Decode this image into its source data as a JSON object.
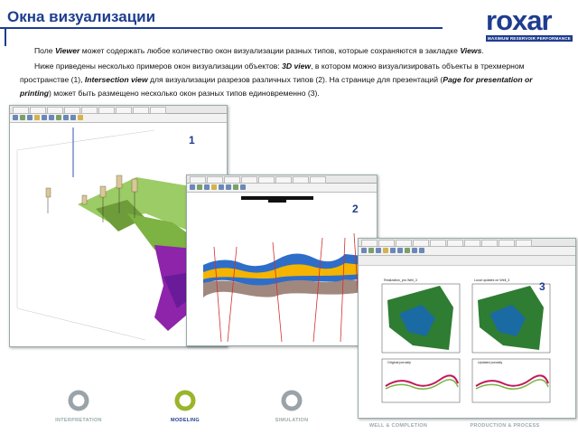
{
  "header": {
    "title": "Окна визуализации",
    "logo_text": "roxar",
    "logo_tagline": "MAXIMUM RESERVOIR PERFORMANCE"
  },
  "body_text": {
    "p1_a": "Поле ",
    "p1_b": "Viewer",
    "p1_c": " может содержать любое количество окон визуализации разных типов, которые сохраняются в закладке ",
    "p1_d": "Views",
    "p1_e": ".",
    "p2_a": "Ниже приведены несколько примеров окон визуализации объектов: ",
    "p2_b": "3D view",
    "p2_c": ", в котором можно визуализировать объекты в трехмерном пространстве (1), ",
    "p2_d": "Intersection view",
    "p2_e": " для визуализации разрезов различных типов (2). На странице для презентаций (",
    "p2_f": "Page for presentation or printing",
    "p2_g": ") может быть размещено несколько окон разных типов единовременно (3)."
  },
  "figures": {
    "label_1": "1",
    "label_2": "2",
    "label_3": "3",
    "w3_map1_title": "Realization_pro Well_3",
    "w3_map2_title": "Local updates on Well_3",
    "w3_log1_title": "Original porosity",
    "w3_log2_title": "Updated porosity"
  },
  "workflow": {
    "items": [
      {
        "label": "INTERPRETATION",
        "active": false
      },
      {
        "label": "MODELING",
        "active": true
      },
      {
        "label": "SIMULATION",
        "active": false
      },
      {
        "label": "WELL & COMPLETION",
        "active": false
      },
      {
        "label": "PRODUCTION & PROCESS",
        "active": false
      }
    ]
  },
  "colors": {
    "brand": "#1f3d8f",
    "inactive": "#9aa3a8",
    "active_ring": "#9ab52a"
  }
}
